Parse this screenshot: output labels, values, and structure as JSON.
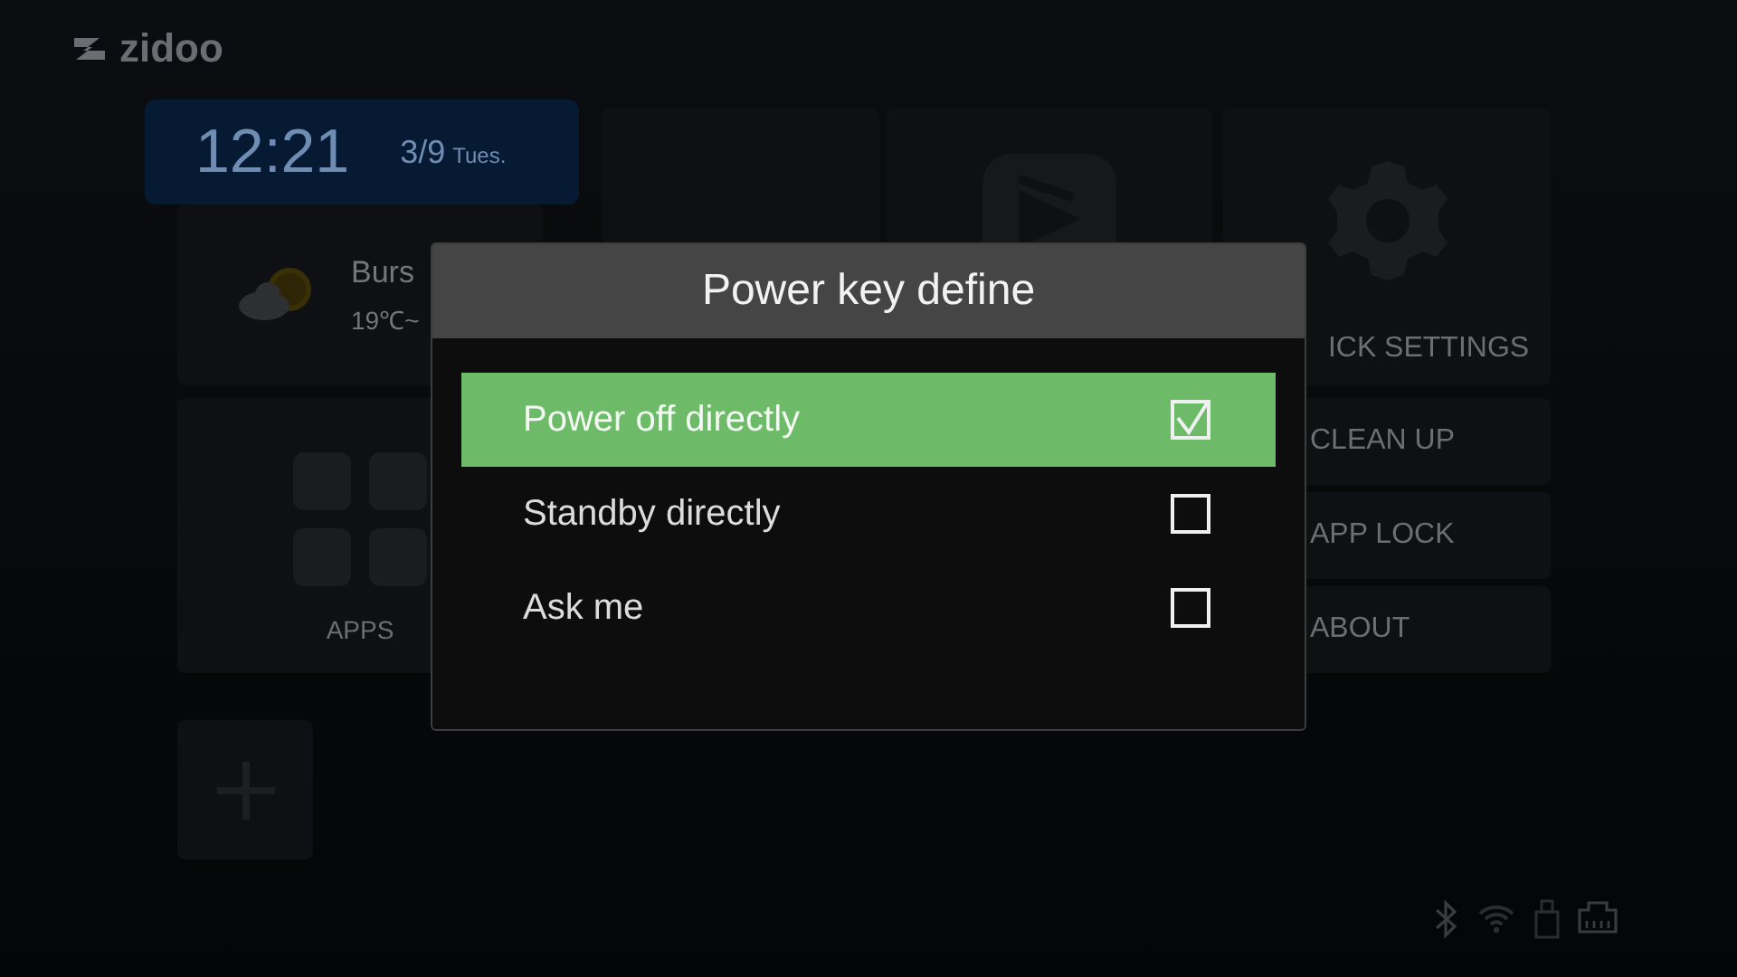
{
  "logo": {
    "text": "zidoo"
  },
  "clock": {
    "time": "12:21",
    "date": "3/9",
    "weekday": "Tues."
  },
  "weather": {
    "city": "Burs",
    "temperature": "19℃~"
  },
  "apps_tile": {
    "label": "APPS"
  },
  "settings_tile": {
    "label": "ICK SETTINGS"
  },
  "side_buttons": [
    {
      "label": "CLEAN UP"
    },
    {
      "label": "APP LOCK"
    },
    {
      "label": "ABOUT"
    }
  ],
  "dialog": {
    "title": "Power key define",
    "options": [
      {
        "label": "Power off directly",
        "selected": true,
        "checked": true
      },
      {
        "label": "Standby directly",
        "selected": false,
        "checked": false
      },
      {
        "label": "Ask me",
        "selected": false,
        "checked": false
      }
    ]
  }
}
